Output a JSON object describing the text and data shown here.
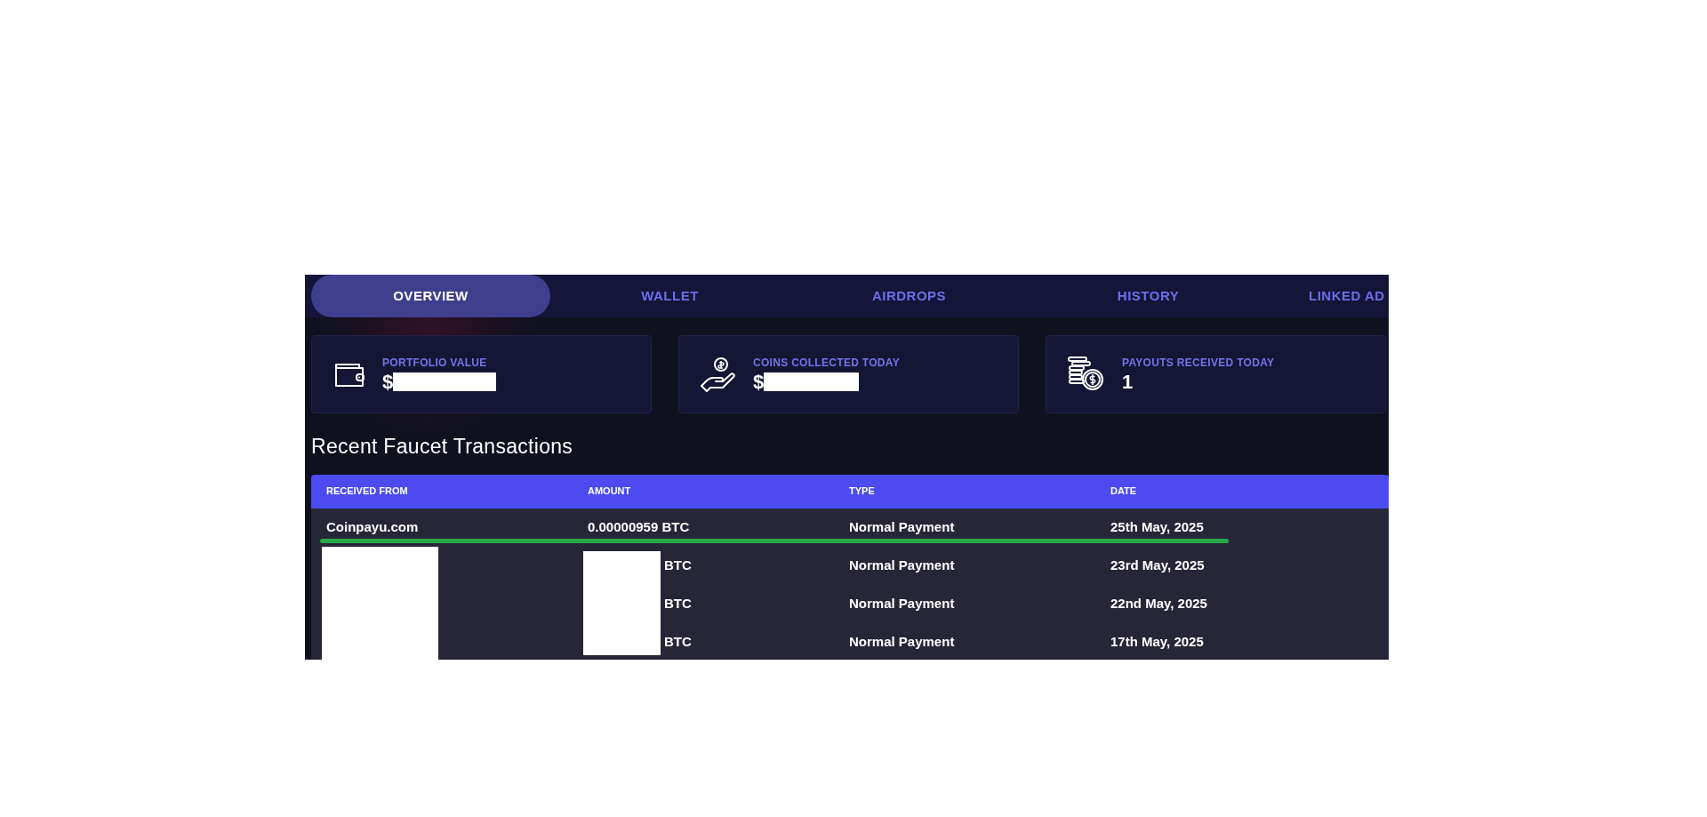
{
  "tabs": [
    {
      "label": "OVERVIEW",
      "selected": true
    },
    {
      "label": "WALLET",
      "selected": false
    },
    {
      "label": "AIRDROPS",
      "selected": false
    },
    {
      "label": "HISTORY",
      "selected": false
    },
    {
      "label": "LINKED AD",
      "selected": false
    }
  ],
  "stats": [
    {
      "kind": "wallet",
      "label": "PORTFOLIO VALUE",
      "value": "$",
      "redacted": true
    },
    {
      "kind": "hand",
      "label": "COINS COLLECTED TODAY",
      "value": "$",
      "redacted": true
    },
    {
      "kind": "coins",
      "label": "PAYOUTS RECEIVED TODAY",
      "value": "1",
      "redacted": false
    }
  ],
  "transactions": {
    "title": "Recent Faucet Transactions",
    "columns": [
      "RECEIVED FROM",
      "AMOUNT",
      "TYPE",
      "DATE"
    ],
    "rows": [
      {
        "received_from": "Coinpayu.com",
        "amount": "0.00000959 BTC",
        "type": "Normal Payment",
        "date": "25th May, 2025",
        "underlined": true,
        "redacted": false
      },
      {
        "amount": "BTC",
        "type": "Normal Payment",
        "date": "23rd May, 2025",
        "underlined": false,
        "redacted": true
      },
      {
        "amount": "BTC",
        "type": "Normal Payment",
        "date": "22nd May, 2025",
        "underlined": false,
        "redacted": true
      },
      {
        "amount": "BTC",
        "type": "Normal Payment",
        "date": "17th May, 2025",
        "underlined": false,
        "redacted": true
      }
    ]
  }
}
